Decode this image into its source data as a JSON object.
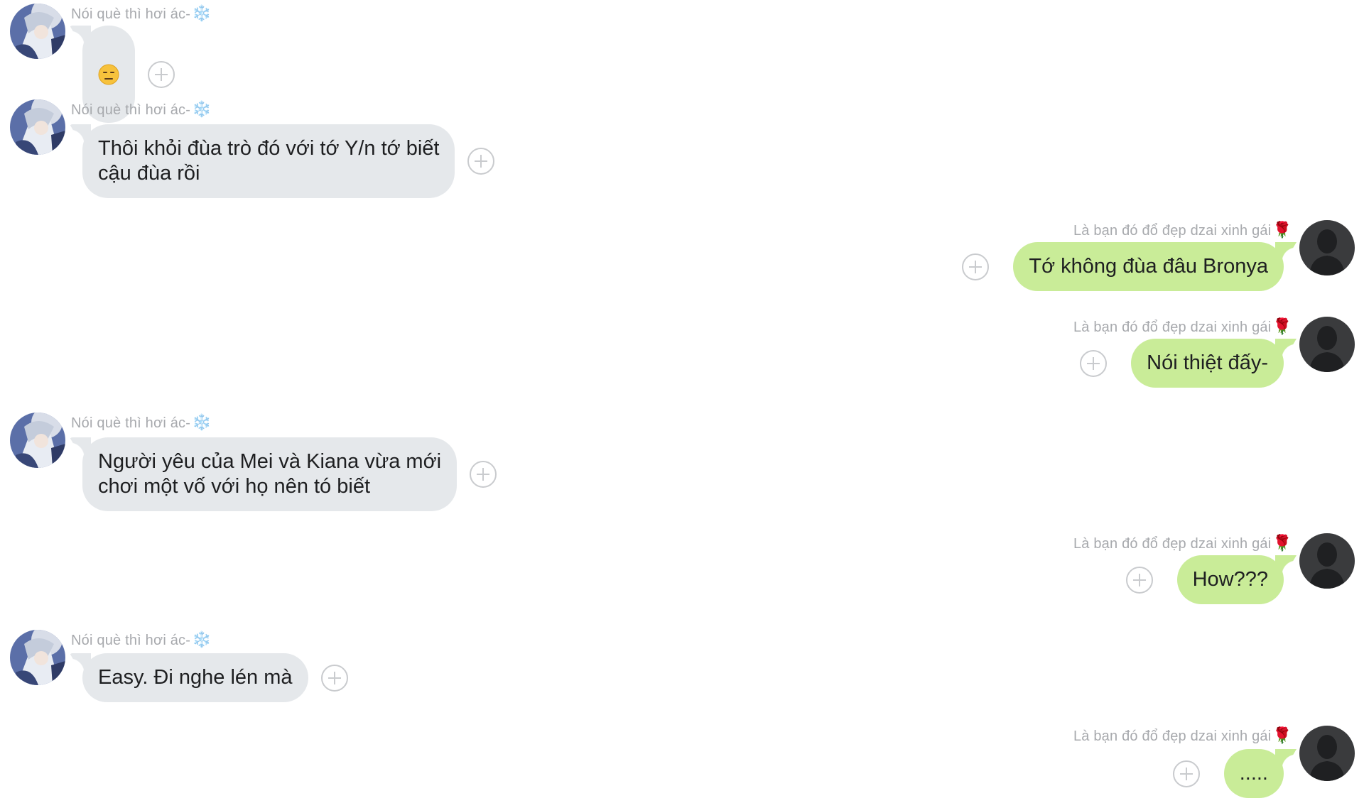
{
  "contacts": {
    "other": {
      "name": "Nói què thì hơi ác-",
      "name_deco": "❄️",
      "avatar_icon": "anime-character-avatar"
    },
    "self": {
      "name": "Là bạn đó đổ đẹp dzai xinh gái",
      "name_deco": "🌹",
      "avatar_icon": "default-person-avatar"
    }
  },
  "colors": {
    "incoming_bubble": "#e5e8eb",
    "outgoing_bubble": "#c9ec98",
    "sender_text": "#a7a9ad",
    "message_text": "#1e1f21"
  },
  "messages": [
    {
      "side": "left",
      "sender": "Nói què thì hơi ác-",
      "deco": "❄️",
      "text": "😑",
      "is_emoji": true
    },
    {
      "side": "left",
      "sender": "Nói què thì hơi ác-",
      "deco": "❄️",
      "text": "Thôi khỏi đùa trò đó với tớ Y/n tớ biết\ncậu đùa rồi"
    },
    {
      "side": "right",
      "sender": "Là bạn đó đổ đẹp dzai xinh gái",
      "deco": "🌹",
      "text": "Tớ không đùa đâu Bronya"
    },
    {
      "side": "right",
      "sender": "Là bạn đó đổ đẹp dzai xinh gái",
      "deco": "🌹",
      "text": "Nói thiệt đấy-"
    },
    {
      "side": "left",
      "sender": "Nói què thì hơi ác-",
      "deco": "❄️",
      "text": "Người yêu của Mei và Kiana vừa mới\nchơi một vố với họ nên tó biết"
    },
    {
      "side": "right",
      "sender": "Là bạn đó đổ đẹp dzai xinh gái",
      "deco": "🌹",
      "text": "How???"
    },
    {
      "side": "left",
      "sender": "Nói què thì hơi ác-",
      "deco": "❄️",
      "text": "Easy. Đi nghe lén mà"
    },
    {
      "side": "right",
      "sender": "Là bạn đó đổ đẹp dzai xinh gái",
      "deco": "🌹",
      "text": "....."
    }
  ]
}
